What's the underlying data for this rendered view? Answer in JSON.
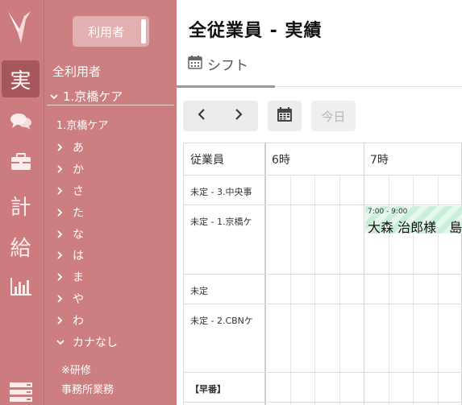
{
  "app": {
    "title": "全従業員 - 実績",
    "tab": "シフト"
  },
  "rail": {
    "items": [
      {
        "id": "actual",
        "label": "実",
        "active": true
      },
      {
        "id": "chat",
        "icon": "chat-icon"
      },
      {
        "id": "work",
        "icon": "briefcase-icon"
      },
      {
        "id": "plan",
        "label": "計"
      },
      {
        "id": "salary",
        "label": "給"
      },
      {
        "id": "report",
        "icon": "bar-chart-icon"
      },
      {
        "id": "settings",
        "icon": "server-icon"
      }
    ]
  },
  "sidebar": {
    "role_button": "利用者",
    "all_users": "全利用者",
    "office": "1.京橋ケア",
    "office_sub": "1.京橋ケア",
    "kana_groups": [
      "あ",
      "か",
      "さ",
      "た",
      "な",
      "は",
      "ま",
      "や",
      "わ",
      "カナなし"
    ],
    "extras": [
      "※研修",
      "事務所業務"
    ]
  },
  "toolbar": {
    "prev": "prev",
    "next": "next",
    "today": "今日"
  },
  "schedule": {
    "employee_header": "従業員",
    "hours": [
      "6時",
      "7時"
    ],
    "rows": [
      "未定 - 3.中央事",
      "未定 - 1.京橋ケ",
      "未定",
      "未定 - 2.CBNケ",
      "【早番】"
    ],
    "shift": {
      "time": "7:00 - 9:00",
      "name": "大森 治郎様　島"
    }
  },
  "colors": {
    "rail_bg": "#cc7c7f",
    "sidebar_bg": "#cd7e81",
    "active_rail": "#a7565b",
    "shift_bar": "#c9efd8"
  }
}
